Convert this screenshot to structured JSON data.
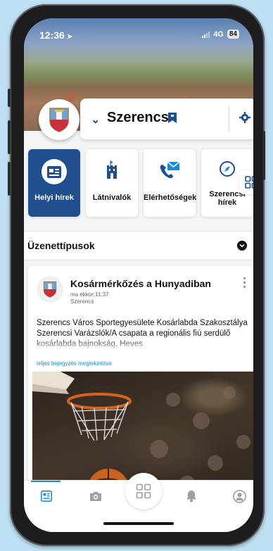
{
  "status_bar": {
    "time": "12:36",
    "network": "4G",
    "battery": "84"
  },
  "header": {
    "city_name": "Szerencs"
  },
  "categories": [
    {
      "label": "Helyi hírek",
      "active": true
    },
    {
      "label": "Látnivalók",
      "active": false
    },
    {
      "label": "Elérhetőségek",
      "active": false
    },
    {
      "label": "Szerencsi hírek",
      "active": false
    }
  ],
  "filter": {
    "label": "Üzenettípusok"
  },
  "post": {
    "title": "Kosármérkőzés a Hunyadiban",
    "time": "ma ekkor:11:37",
    "source": "Szerencs",
    "body": "Szerencs Város Sportegyesülete Kosárlabda Szakosztálya Szerencsi Varázslók/A csapata a regionális fiú serdülő kosárlabda bajnokság, Heves",
    "more_link": "teljes bejegyzés megtekintése"
  },
  "tabbar": {
    "items": [
      "feed-icon",
      "camera-icon",
      "grid-icon",
      "bell-icon",
      "profile-icon"
    ]
  },
  "colors": {
    "brand": "#1f4f8f",
    "link": "#1a8bd6",
    "background": "#bfe0f4"
  }
}
